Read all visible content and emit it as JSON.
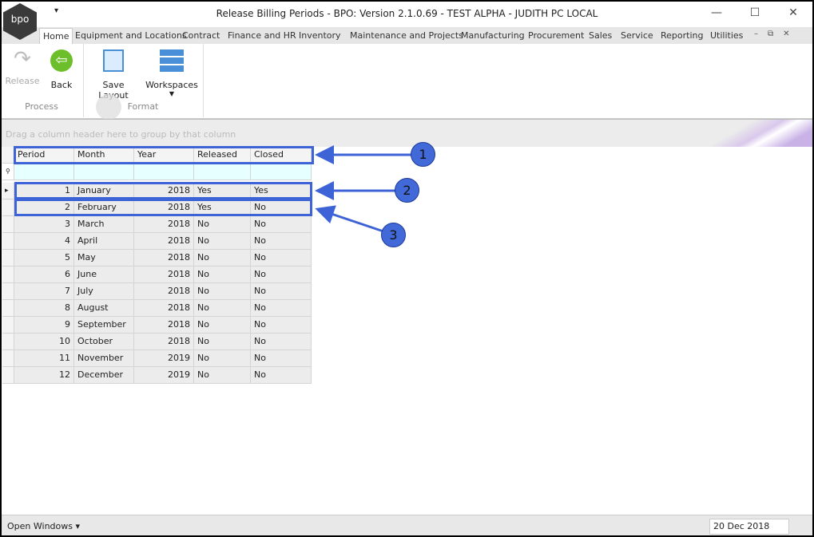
{
  "window": {
    "title": "Release Billing Periods - BPO: Version 2.1.0.69 - TEST ALPHA - JUDITH PC LOCAL",
    "logo": "bpo"
  },
  "tabs": [
    "Home",
    "Equipment and Locations",
    "Contract",
    "Finance and HR",
    "Inventory",
    "Maintenance and Projects",
    "Manufacturing",
    "Procurement",
    "Sales",
    "Service",
    "Reporting",
    "Utilities"
  ],
  "ribbon": {
    "release": "Release",
    "back": "Back",
    "save_layout": "Save Layout",
    "workspaces": "Workspaces",
    "process": "Process",
    "format": "Format"
  },
  "grid": {
    "group_hint": "Drag a column header here to group by that column",
    "columns": [
      "Period",
      "Month",
      "Year",
      "Released",
      "Closed"
    ],
    "rows": [
      [
        "1",
        "January",
        "2018",
        "Yes",
        "Yes"
      ],
      [
        "2",
        "February",
        "2018",
        "Yes",
        "No"
      ],
      [
        "3",
        "March",
        "2018",
        "No",
        "No"
      ],
      [
        "4",
        "April",
        "2018",
        "No",
        "No"
      ],
      [
        "5",
        "May",
        "2018",
        "No",
        "No"
      ],
      [
        "6",
        "June",
        "2018",
        "No",
        "No"
      ],
      [
        "7",
        "July",
        "2018",
        "No",
        "No"
      ],
      [
        "8",
        "August",
        "2018",
        "No",
        "No"
      ],
      [
        "9",
        "September",
        "2018",
        "No",
        "No"
      ],
      [
        "10",
        "October",
        "2018",
        "No",
        "No"
      ],
      [
        "11",
        "November",
        "2019",
        "No",
        "No"
      ],
      [
        "12",
        "December",
        "2019",
        "No",
        "No"
      ]
    ]
  },
  "status": {
    "open_windows": "Open Windows",
    "date": "20 Dec 2018"
  },
  "callouts": [
    "1",
    "2",
    "3"
  ],
  "accent": "#3e63d6"
}
